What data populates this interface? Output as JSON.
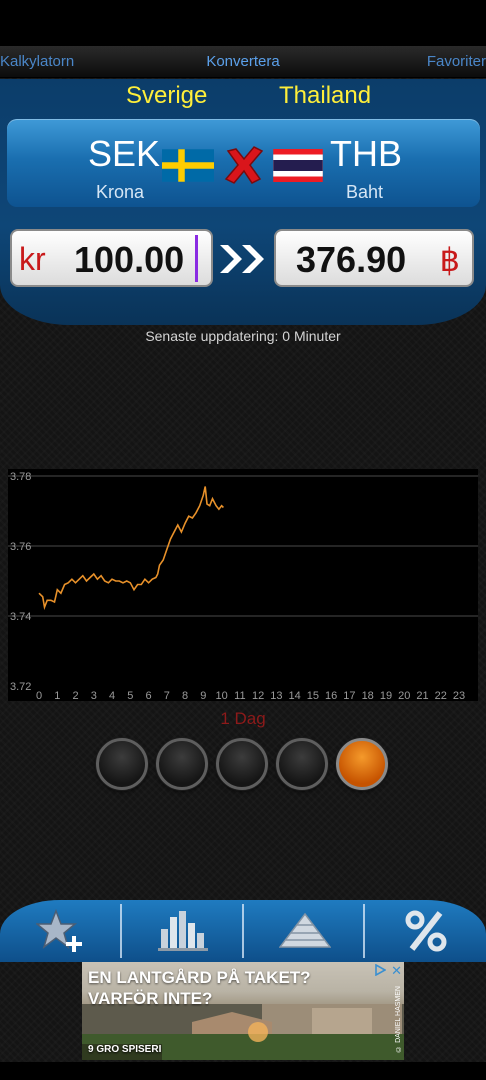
{
  "nav": {
    "left": "Kalkylatorn",
    "center": "Konvertera",
    "right": "Favoriter"
  },
  "from": {
    "country": "Sverige",
    "code": "SEK",
    "name": "Krona",
    "symbol": "kr",
    "amount": "100.00"
  },
  "to": {
    "country": "Thailand",
    "code": "THB",
    "name": "Baht",
    "symbol": "฿",
    "amount": "376.90"
  },
  "updated": "Senaste uppdatering: 0 Minuter",
  "range_label": "1 Dag",
  "range_buttons": {
    "count": 5,
    "active_index": 4
  },
  "tabs": [
    "star-add-icon",
    "bar-chart-icon",
    "pyramid-icon",
    "percent-icon"
  ],
  "ad": {
    "line1": "EN LANTGÅRD PÅ TAKET?",
    "line2": "VARFÖR INTE?",
    "brand": "9 GRO SPISERI",
    "credit": "© DANIEL HASMEN"
  },
  "colors": {
    "nav_link": "#4a86c8",
    "country": "#ffef3a",
    "accent_red": "#c8191a",
    "chart_line": "#e8912a",
    "range_label": "#8d1a1a",
    "active_button": "#e0741a"
  },
  "chart_data": {
    "type": "line",
    "x_ticks": [
      "0",
      "1",
      "2",
      "3",
      "4",
      "5",
      "6",
      "7",
      "8",
      "9",
      "10",
      "11",
      "12",
      "13",
      "14",
      "15",
      "16",
      "17",
      "18",
      "19",
      "20",
      "21",
      "22",
      "23"
    ],
    "y_ticks": [
      "3.78",
      "3.76",
      "3.74",
      "3.72"
    ],
    "ylim": [
      3.72,
      3.78
    ],
    "xlim": [
      0,
      23
    ],
    "grid": true,
    "series": [
      {
        "points": [
          [
            0.0,
            3.7465
          ],
          [
            0.2,
            3.7455
          ],
          [
            0.3,
            3.7425
          ],
          [
            0.45,
            3.7445
          ],
          [
            0.65,
            3.7445
          ],
          [
            0.85,
            3.744
          ],
          [
            1.0,
            3.7475
          ],
          [
            1.2,
            3.7465
          ],
          [
            1.4,
            3.749
          ],
          [
            1.6,
            3.7495
          ],
          [
            1.8,
            3.7505
          ],
          [
            2.0,
            3.7495
          ],
          [
            2.2,
            3.7505
          ],
          [
            2.4,
            3.7515
          ],
          [
            2.6,
            3.75
          ],
          [
            2.8,
            3.751
          ],
          [
            3.0,
            3.752
          ],
          [
            3.2,
            3.7505
          ],
          [
            3.4,
            3.7515
          ],
          [
            3.6,
            3.75
          ],
          [
            3.8,
            3.7495
          ],
          [
            4.0,
            3.7505
          ],
          [
            4.2,
            3.75
          ],
          [
            4.4,
            3.75
          ],
          [
            4.6,
            3.7495
          ],
          [
            4.8,
            3.75
          ],
          [
            5.0,
            3.7495
          ],
          [
            5.2,
            3.7475
          ],
          [
            5.4,
            3.749
          ],
          [
            5.6,
            3.749
          ],
          [
            5.8,
            3.7505
          ],
          [
            6.0,
            3.7495
          ],
          [
            6.2,
            3.7505
          ],
          [
            6.4,
            3.751
          ],
          [
            6.5,
            3.752
          ],
          [
            6.6,
            3.7545
          ],
          [
            6.8,
            3.756
          ],
          [
            7.0,
            3.759
          ],
          [
            7.2,
            3.762
          ],
          [
            7.4,
            3.764
          ],
          [
            7.6,
            3.766
          ],
          [
            7.8,
            3.764
          ],
          [
            8.0,
            3.7665
          ],
          [
            8.2,
            3.7685
          ],
          [
            8.4,
            3.768
          ],
          [
            8.6,
            3.7695
          ],
          [
            8.8,
            3.7715
          ],
          [
            9.0,
            3.7745
          ],
          [
            9.1,
            3.777
          ],
          [
            9.2,
            3.772
          ],
          [
            9.35,
            3.7715
          ],
          [
            9.5,
            3.7735
          ],
          [
            9.7,
            3.7715
          ],
          [
            9.85,
            3.7705
          ],
          [
            10.0,
            3.7715
          ],
          [
            10.1,
            3.771
          ]
        ]
      }
    ]
  }
}
